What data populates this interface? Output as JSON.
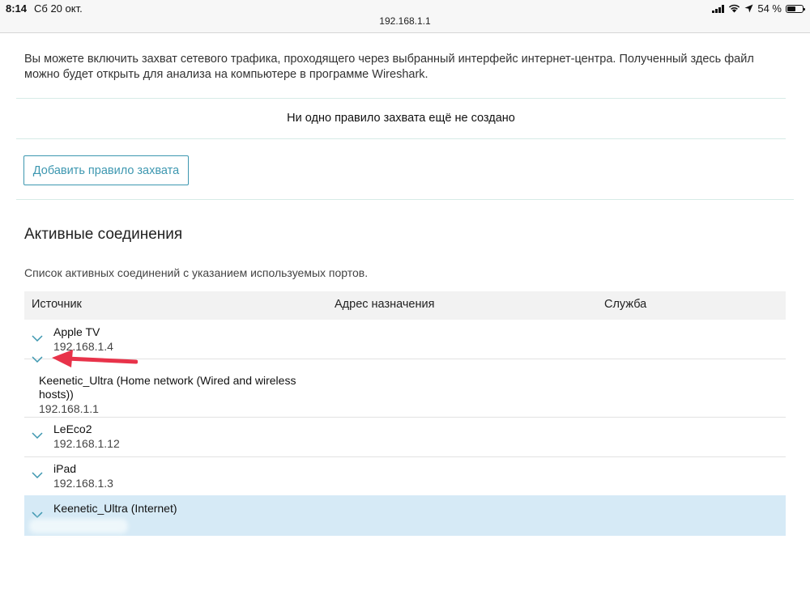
{
  "status_bar": {
    "time": "8:14",
    "date": "Сб 20 окт.",
    "url": "192.168.1.1",
    "battery": "54 %",
    "battery_level": 0.54
  },
  "capture": {
    "intro": "Вы можете включить захват сетевого трафика, проходящего через выбранный интерфейс интернет-центра. Полученный здесь файл можно будет открыть для анализа на компьютере в программе Wireshark.",
    "empty_note": "Ни одно правило захвата ещё не создано",
    "add_button": "Добавить правило захвата"
  },
  "connections": {
    "title": "Активные соединения",
    "description": "Список активных соединений с указанием используемых портов.",
    "columns": {
      "source": "Источник",
      "destination": "Адрес назначения",
      "service": "Служба"
    },
    "rows": [
      {
        "name": "Apple TV",
        "ip": "192.168.1.4"
      },
      {
        "name": "Keenetic_Ultra (Home network (Wired and wireless hosts))",
        "ip": "192.168.1.1"
      },
      {
        "name": "LeEco2",
        "ip": "192.168.1.12"
      },
      {
        "name": "iPad",
        "ip": "192.168.1.3"
      },
      {
        "name": "Keenetic_Ultra (Internet)",
        "ip": ""
      }
    ]
  },
  "colors": {
    "accent": "#3d97b0",
    "divider": "#d6ebe7",
    "selected_row": "#d6eaf6",
    "annotation_arrow": "#e8334a"
  }
}
